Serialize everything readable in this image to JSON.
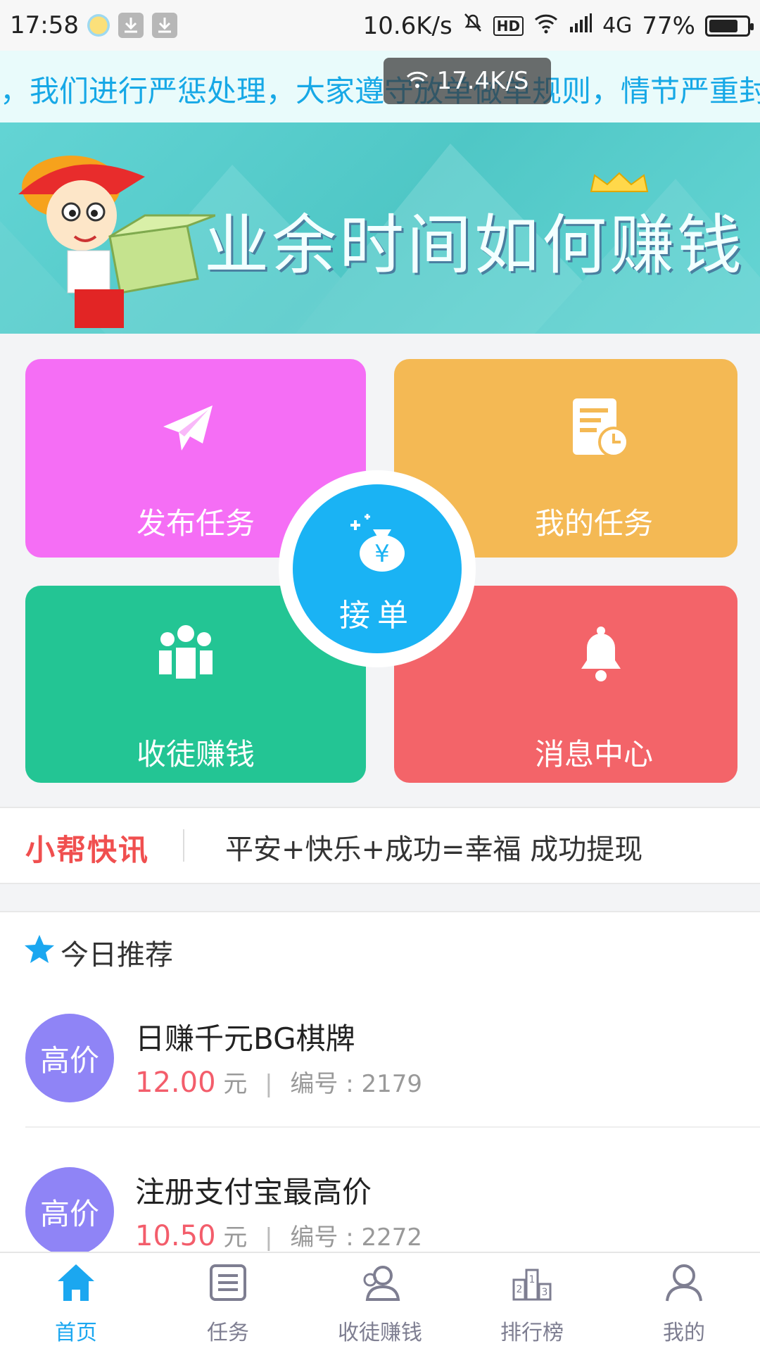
{
  "status_bar": {
    "time": "17:58",
    "net_speed": "10.6K/s",
    "hd": "HD",
    "network": "4G",
    "battery_pct": "77%",
    "battery_level": 0.77
  },
  "notice": {
    "text": "，我们进行严惩处理，大家遵守放单做单规则，情节严重封号"
  },
  "speed_toast": {
    "text": "17.4K/S"
  },
  "banner": {
    "title": "业余时间如何赚钱"
  },
  "grid": {
    "publish": {
      "label": "发布任务",
      "color": "#f56ef5"
    },
    "my_tasks": {
      "label": "我的任务",
      "color": "#f4b954"
    },
    "recruit": {
      "label": "收徒赚钱",
      "color": "#23c594"
    },
    "messages": {
      "label": "消息中心",
      "color": "#f36469"
    },
    "center": {
      "label": "接单",
      "color": "#1ab3f4"
    }
  },
  "news": {
    "brand": "小帮快讯",
    "message": "平安+快乐+成功=幸福 成功提现"
  },
  "recommend": {
    "title": "今日推荐"
  },
  "items": [
    {
      "badge": "高价",
      "name": "日赚千元BG棋牌",
      "price": "12.00",
      "unit": "元",
      "sep": "|",
      "id_label": "编号 : 2179"
    },
    {
      "badge": "高价",
      "name": "注册支付宝最高价",
      "price": "10.50",
      "unit": "元",
      "sep": "|",
      "id_label": "编号 : 2272"
    }
  ],
  "tabs": [
    {
      "label": "首页",
      "icon": "home-icon",
      "active": true
    },
    {
      "label": "任务",
      "icon": "task-list-icon",
      "active": false
    },
    {
      "label": "收徒赚钱",
      "icon": "recruit-icon",
      "active": false
    },
    {
      "label": "排行榜",
      "icon": "ranking-icon",
      "active": false
    },
    {
      "label": "我的",
      "icon": "profile-icon",
      "active": false
    }
  ],
  "colors": {
    "accent": "#1ba7f0",
    "price": "#f35d6b",
    "badge": "#8f84f6",
    "news_brand": "#f04f4f"
  }
}
